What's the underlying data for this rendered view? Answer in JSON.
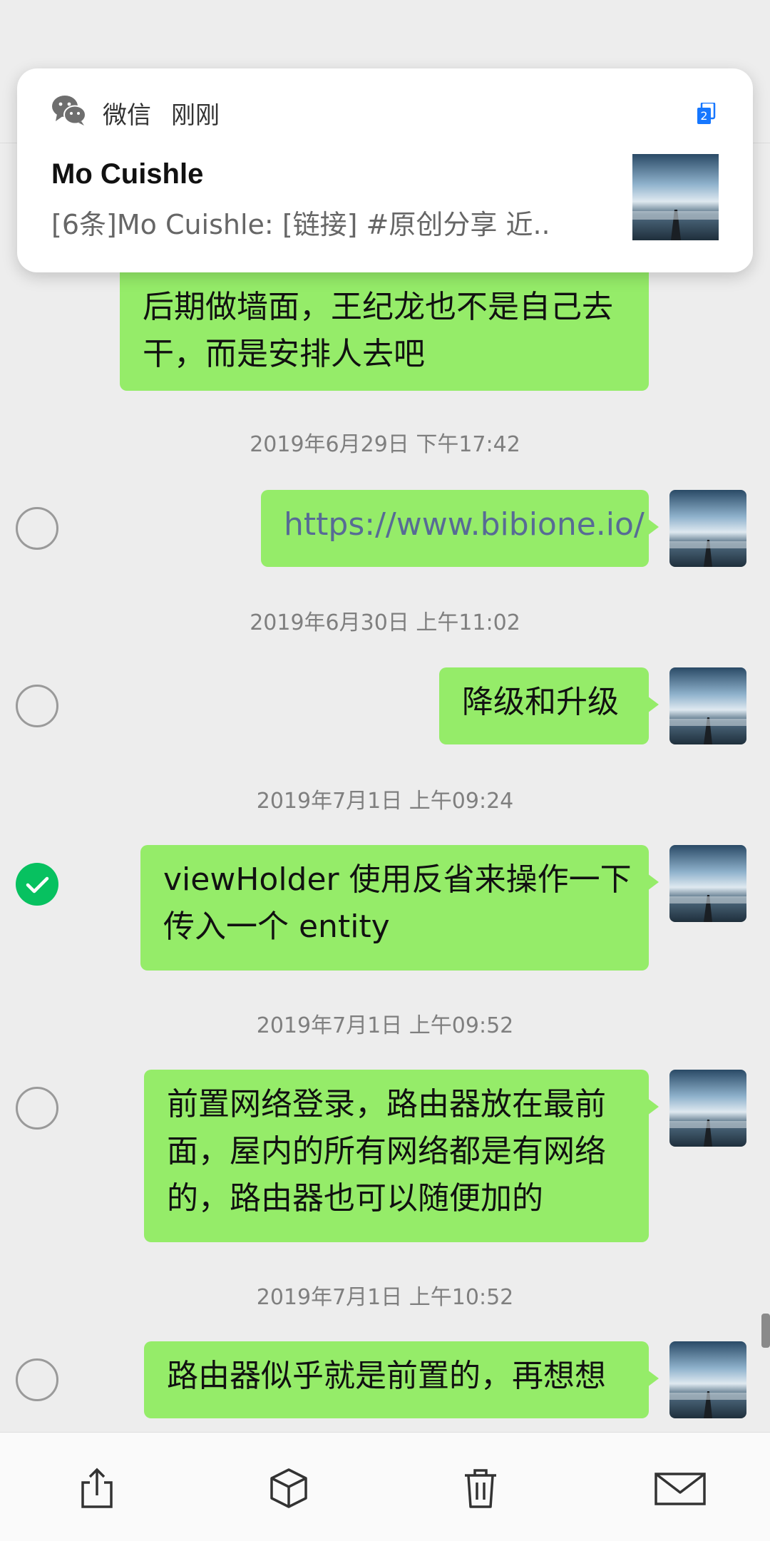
{
  "notification": {
    "app_name": "微信",
    "time": "刚刚",
    "badge_count": "2",
    "title": "Mo Cuishle",
    "text": "[6条]Mo Cuishle: [链接] #原创分享 近.."
  },
  "messages": [
    {
      "lines": [
        "后期做墙面，王纪龙也不是自己去",
        "干，而是安排人去吧"
      ]
    },
    {
      "timestamp": "2019年6月29日 下午17:42",
      "lines": [
        "https://www.bibione.io/"
      ],
      "checked": false
    },
    {
      "timestamp": "2019年6月30日 上午11:02",
      "lines": [
        "降级和升级"
      ],
      "checked": false
    },
    {
      "timestamp": "2019年7月1日 上午09:24",
      "lines": [
        "viewHolder 使用反省来操作一下",
        "传入一个 entity"
      ],
      "checked": true
    },
    {
      "timestamp": "2019年7月1日 上午09:52",
      "lines": [
        "前置网络登录，路由器放在最前",
        "面，屋内的所有网络都是有网络",
        "的，路由器也可以随便加的"
      ],
      "checked": false
    },
    {
      "timestamp": "2019年7月1日 上午10:52",
      "lines": [
        "路由器似乎就是前置的，再想想"
      ],
      "checked": false
    }
  ],
  "bottom_actions": [
    "share-icon",
    "box-icon",
    "trash-icon",
    "mail-icon"
  ],
  "colors": {
    "bubble": "#95ec69",
    "check": "#07c160",
    "link": "#576b95"
  }
}
